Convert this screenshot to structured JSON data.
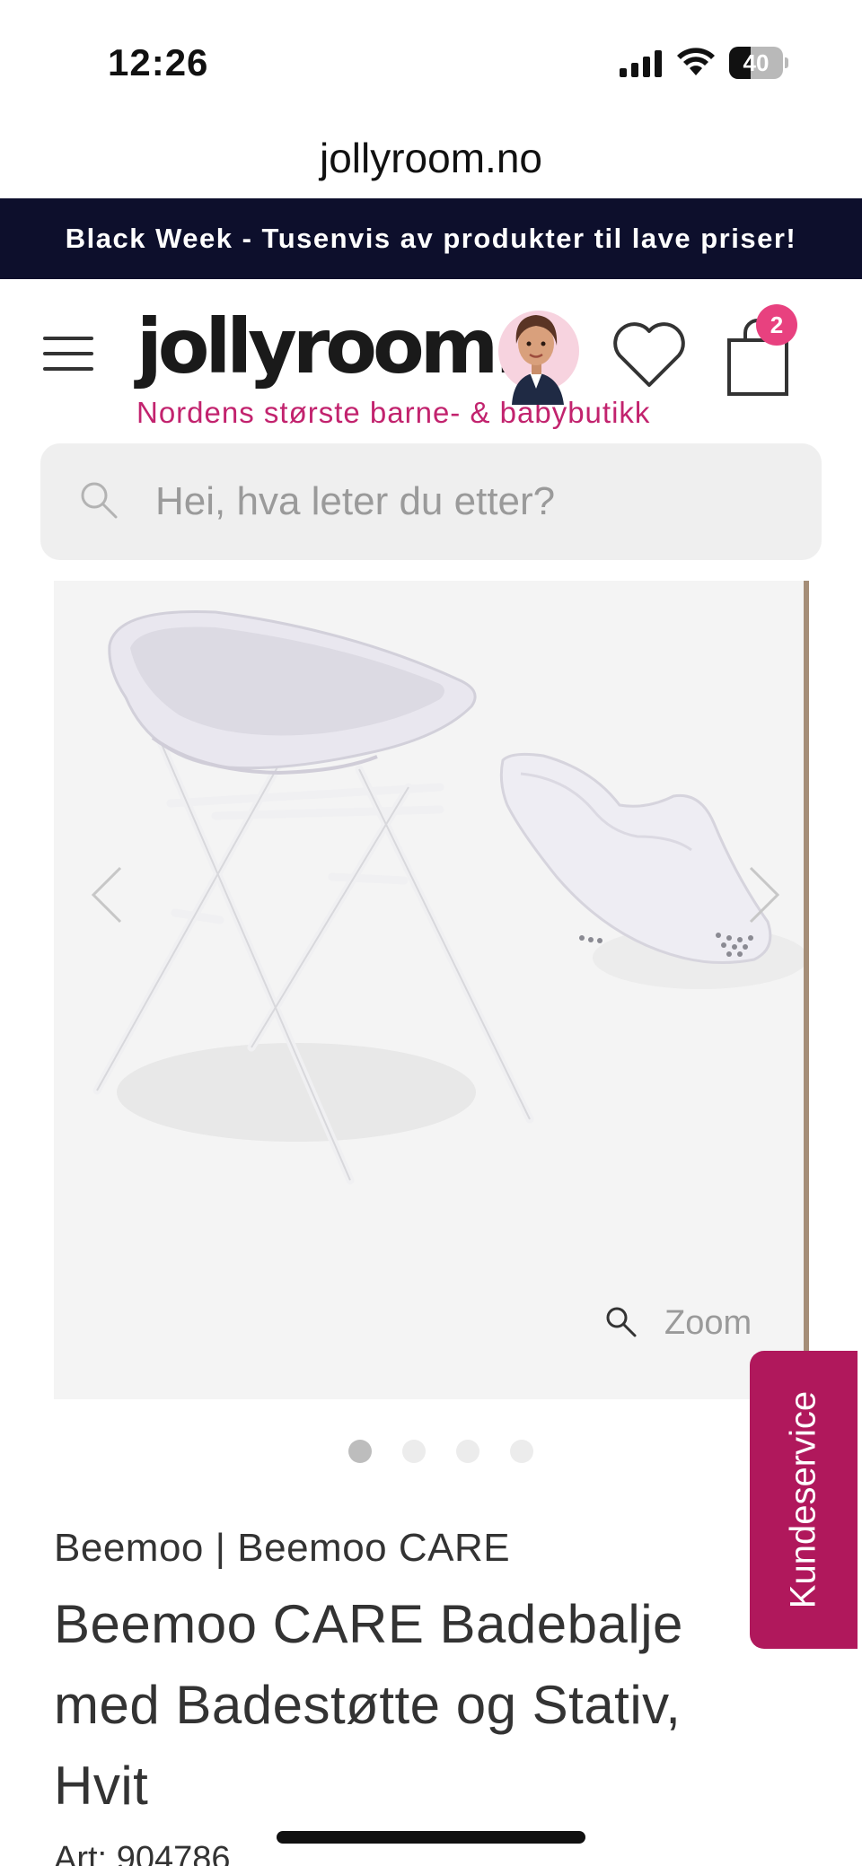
{
  "status_bar": {
    "time": "12:26",
    "battery_level": "40",
    "battery_fraction": 0.4
  },
  "browser": {
    "url": "jollyroom.no"
  },
  "promo_banner": {
    "text": "Black Week - Tusenvis av produkter til lave priser!",
    "background_color": "#0d0f2c"
  },
  "header": {
    "logo_text": "jollyroom.",
    "tagline": "Nordens største barne- & babybutikk",
    "cart_count": "2",
    "accent_color": "#e8417f"
  },
  "search": {
    "placeholder": "Hei, hva leter du etter?"
  },
  "gallery": {
    "zoom_label": "Zoom",
    "image_count": 4,
    "active_index": 0
  },
  "product": {
    "brand_line": "Beemoo | Beemoo CARE",
    "title": "Beemoo CARE Badebalje med Badestøtte og Stativ, Hvit",
    "art_label": "Art:",
    "art_number": "904786"
  },
  "customer_service": {
    "label": "Kundeservice",
    "color": "#b0185c"
  },
  "icons": [
    "signal-icon",
    "wifi-icon",
    "battery-icon",
    "menu-icon",
    "heart-icon",
    "cart-icon",
    "search-icon",
    "chevron-left-icon",
    "chevron-right-icon",
    "zoom-icon"
  ]
}
